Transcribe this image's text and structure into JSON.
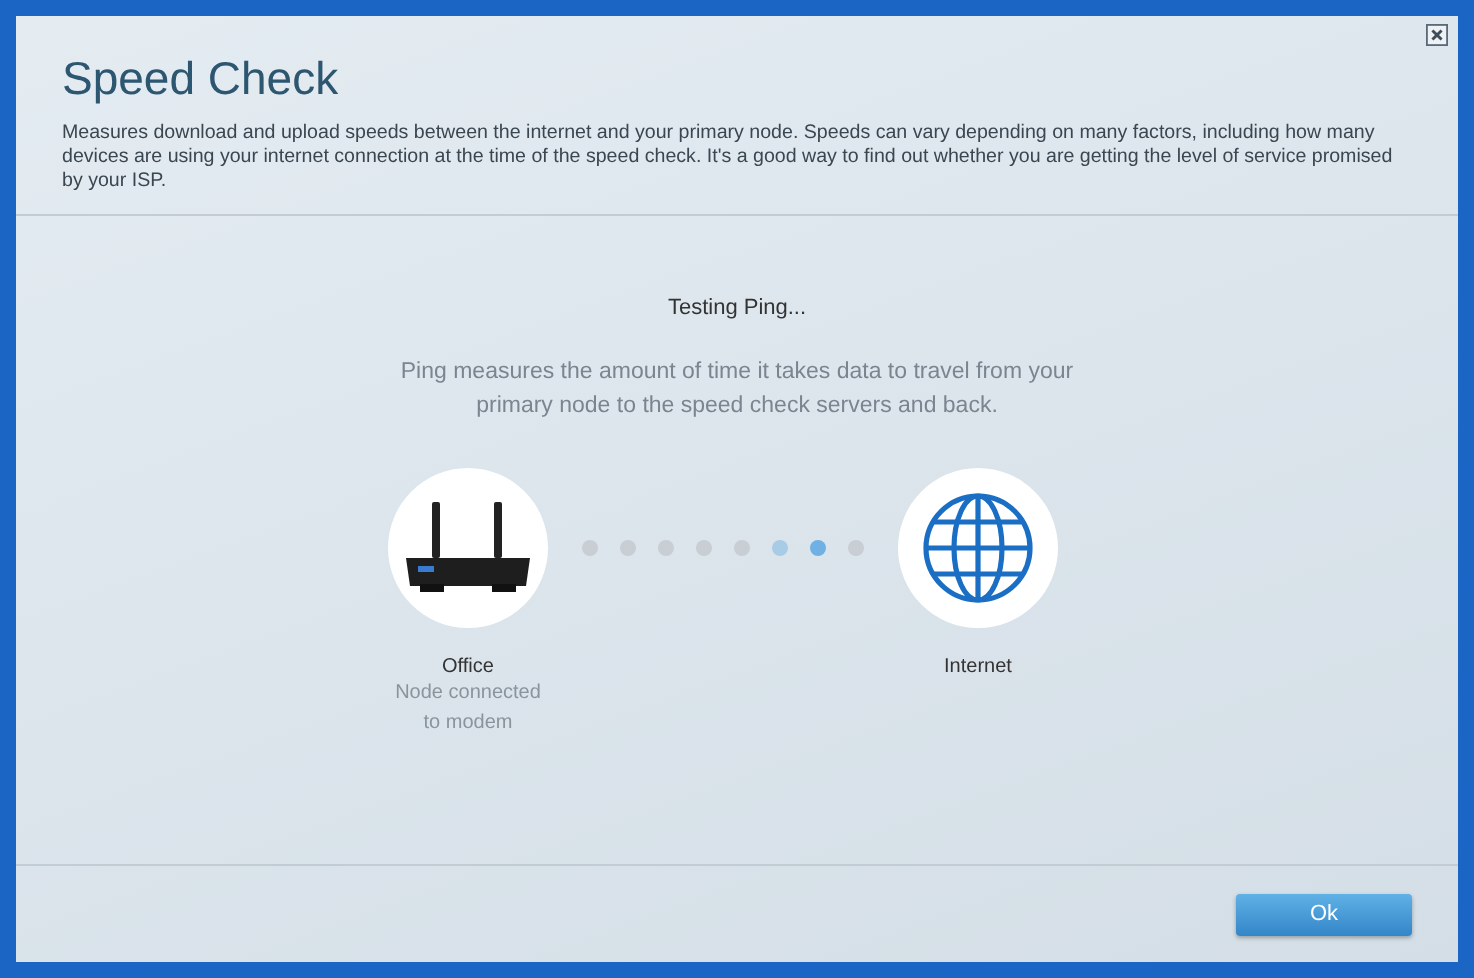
{
  "dialog": {
    "title": "Speed Check",
    "description": "Measures download and upload speeds between the internet and your primary node. Speeds can vary depending on many factors, including how many devices are using your internet connection at the time of the speed check. It's a good way to find out whether you are getting the level of service promised by your ISP."
  },
  "test": {
    "status": "Testing Ping...",
    "explanation": "Ping measures the amount of time it takes data to travel from your primary node to the speed check servers and back."
  },
  "source": {
    "name": "Office",
    "detail": "Node connected to modem"
  },
  "progress_dots": [
    {
      "color": "#c8ced3"
    },
    {
      "color": "#c8ced3"
    },
    {
      "color": "#c8ced3"
    },
    {
      "color": "#c8ced3"
    },
    {
      "color": "#c8ced3"
    },
    {
      "color": "#a8cbe6"
    },
    {
      "color": "#6fb1e4"
    },
    {
      "color": "#c8ced3"
    }
  ],
  "destination": {
    "name": "Internet"
  },
  "buttons": [
    "Ok"
  ]
}
